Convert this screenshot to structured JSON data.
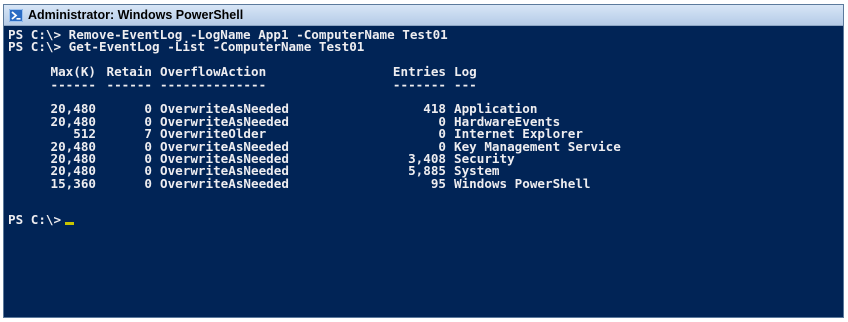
{
  "window": {
    "title": "Administrator: Windows PowerShell"
  },
  "console": {
    "commands": [
      "PS C:\\> Remove-EventLog -LogName App1 -ComputerName Test01",
      "PS C:\\> Get-EventLog -List -ComputerName Test01"
    ],
    "headers": {
      "max": "Max(K)",
      "retain": "Retain",
      "overflow": "OverflowAction",
      "entries": "Entries",
      "log": "Log"
    },
    "underlines": {
      "max": "------",
      "retain": "------",
      "overflow": "--------------",
      "entries": "-------",
      "log": "---"
    },
    "rows": [
      {
        "max": "20,480",
        "retain": "0",
        "overflow": "OverwriteAsNeeded",
        "entries": "418",
        "log": "Application"
      },
      {
        "max": "20,480",
        "retain": "0",
        "overflow": "OverwriteAsNeeded",
        "entries": "0",
        "log": "HardwareEvents"
      },
      {
        "max": "512",
        "retain": "7",
        "overflow": "OverwriteOlder",
        "entries": "0",
        "log": "Internet Explorer"
      },
      {
        "max": "20,480",
        "retain": "0",
        "overflow": "OverwriteAsNeeded",
        "entries": "0",
        "log": "Key Management Service"
      },
      {
        "max": "20,480",
        "retain": "0",
        "overflow": "OverwriteAsNeeded",
        "entries": "3,408",
        "log": "Security"
      },
      {
        "max": "20,480",
        "retain": "0",
        "overflow": "OverwriteAsNeeded",
        "entries": "5,885",
        "log": "System"
      },
      {
        "max": "15,360",
        "retain": "0",
        "overflow": "OverwriteAsNeeded",
        "entries": "95",
        "log": "Windows PowerShell"
      }
    ],
    "prompt": "PS C:\\>"
  },
  "colors": {
    "console_background": "#012456",
    "console_text": "#eeedf0",
    "cursor": "#c8c400",
    "titlebar": "#c4d7ee"
  },
  "icons": {
    "window_icon": "powershell-icon"
  }
}
